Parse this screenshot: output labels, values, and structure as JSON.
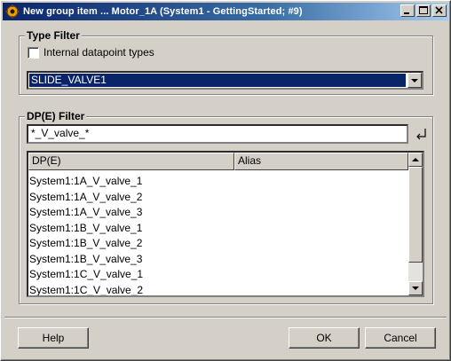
{
  "window": {
    "title": "New group item ... Motor_1A (System1 - GettingStarted; #9)",
    "controls": [
      "minimize",
      "maximize",
      "close"
    ]
  },
  "type_filter": {
    "title": "Type Filter",
    "internal_checkbox_label": "Internal datapoint types",
    "internal_checked": false,
    "selected_type": "SLIDE_VALVE1"
  },
  "dpe_filter": {
    "title": "DP(E) Filter",
    "pattern": "*_V_valve_*",
    "columns": [
      "DP(E)",
      "Alias"
    ],
    "rows": [
      "System1:1A_V_valve_1",
      "System1:1A_V_valve_2",
      "System1:1A_V_valve_3",
      "System1:1B_V_valve_1",
      "System1:1B_V_valve_2",
      "System1:1B_V_valve_3",
      "System1:1C_V_valve_1",
      "System1:1C_V_valve_2"
    ]
  },
  "buttons": {
    "help": "Help",
    "ok": "OK",
    "cancel": "Cancel"
  },
  "colors": {
    "titlebar_start": "#0a246a",
    "titlebar_end": "#a6caf0",
    "selection": "#0a246a",
    "face": "#d4d0c8"
  }
}
